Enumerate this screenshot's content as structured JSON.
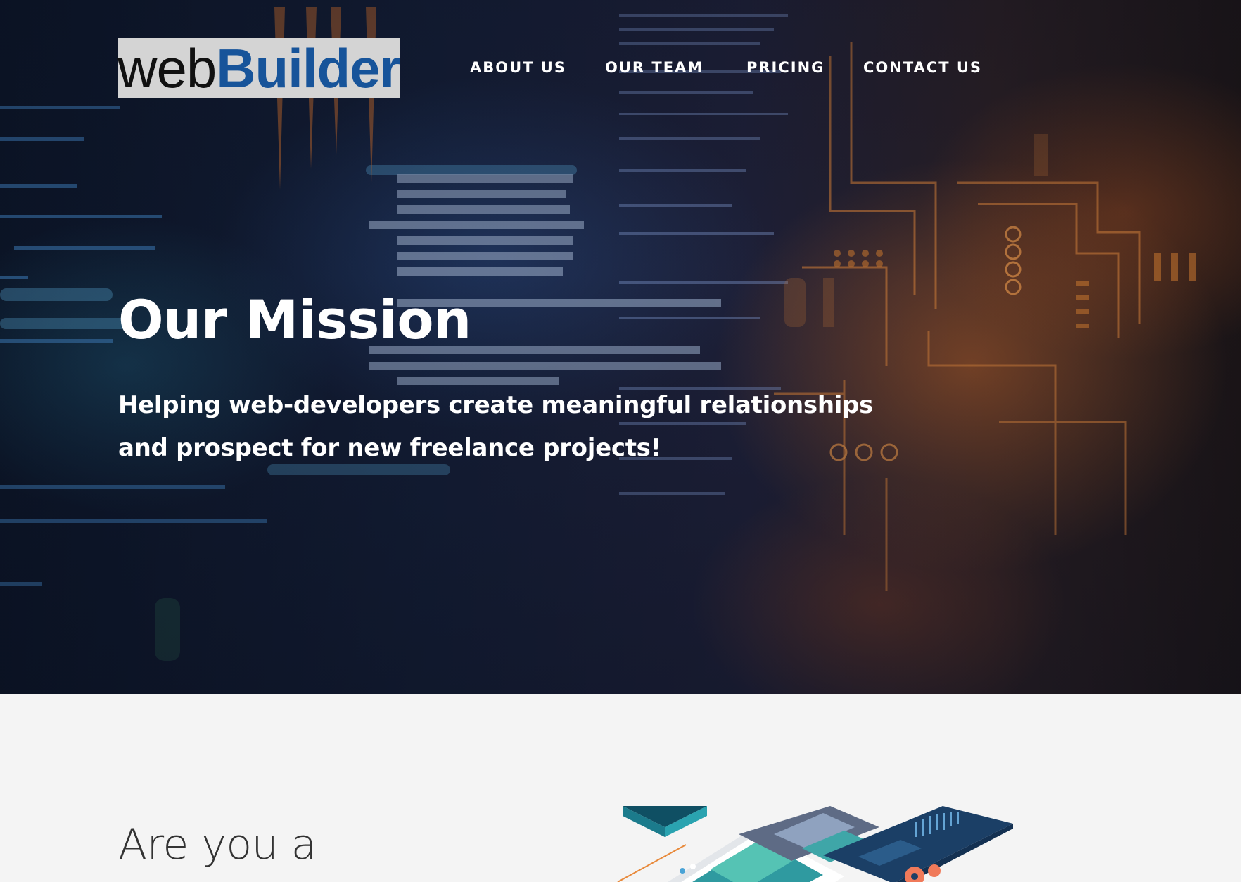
{
  "header": {
    "logo": {
      "part_a": "web",
      "part_b": "Builder"
    },
    "nav": [
      {
        "label": "ABOUT US"
      },
      {
        "label": "OUR TEAM"
      },
      {
        "label": "PRICING"
      },
      {
        "label": "CONTACT US"
      }
    ]
  },
  "hero": {
    "title": "Our Mission",
    "subtitle_line1": "Helping web-developers create meaningful relationships",
    "subtitle_line2": "and prospect for new freelance projects!"
  },
  "section2": {
    "heading": "Are you a"
  },
  "colors": {
    "logo_bg": "#d4d4d4",
    "logo_dark": "#111111",
    "logo_blue": "#17549a",
    "page_bg": "#f4f4f4",
    "text_white": "#ffffff",
    "heading_gray": "#333333"
  },
  "icons": [
    "code-background-image",
    "circuit-board-image",
    "isometric-app-illustration"
  ]
}
